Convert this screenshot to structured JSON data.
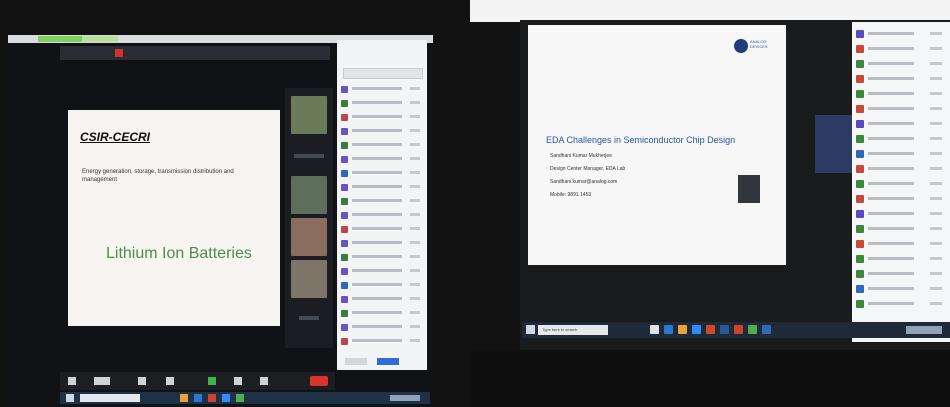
{
  "left_monitor": {
    "slide": {
      "title": "CSIR-CECRI",
      "subtitle": "Energy generation, storage, transmission distribution and management",
      "topic": "Lithium Ion Batteries"
    }
  },
  "right_monitor": {
    "presentation": {
      "title": "EDA Challenges in Semiconductor Chip Design",
      "lines": [
        "Sandhani Kumar Mukherjee",
        "Design Center Manager, EDA Lab",
        "Sandhani.kumar@analog.com",
        "Mobile: 9891 1453"
      ],
      "logo_text": "ANALOG DEVICES"
    },
    "taskbar": {
      "search_placeholder": "Type here to search"
    }
  }
}
